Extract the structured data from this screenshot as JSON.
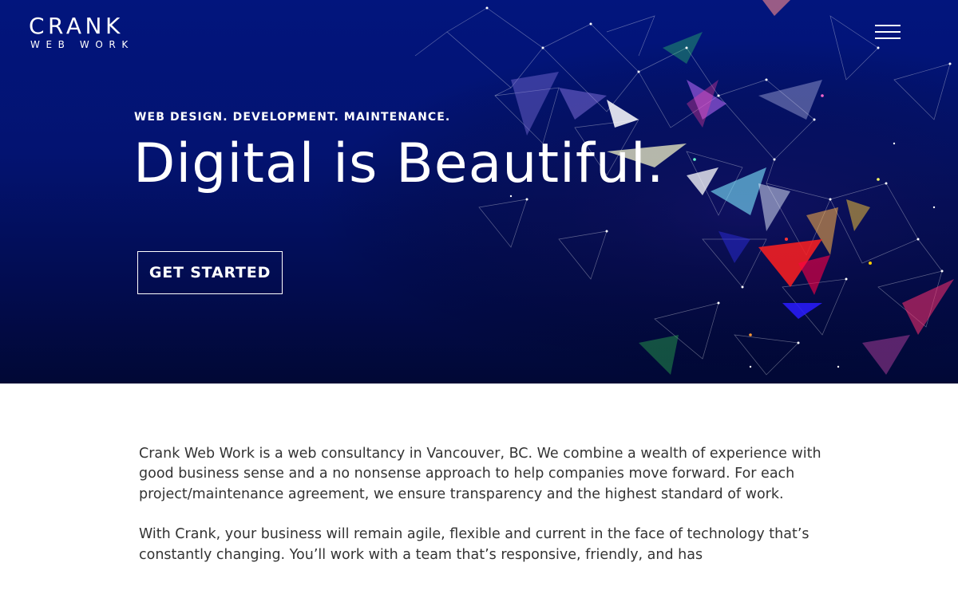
{
  "header": {
    "logo_main": "CRANK",
    "logo_sub": "WEB WORK",
    "menu_icon": "hamburger-menu-icon"
  },
  "hero": {
    "tagline": "WEB DESIGN. DEVELOPMENT. MAINTENANCE.",
    "headline": "Digital is Beautiful.",
    "cta_label": "GET STARTED",
    "background_color": "#02157d",
    "art": "polygon-network"
  },
  "intro": {
    "paragraph_1": "Crank Web Work is a web consultancy in Vancouver, BC. We combine a wealth of experience with good business sense and a no nonsense approach to help companies move forward. For each project/maintenance agreement, we ensure transparency and the highest standard of work.",
    "paragraph_2": "With Crank, your business will remain agile, flexible and current in the face of technology that’s constantly changing. You’ll work with a team that’s responsive, friendly, and has"
  },
  "colors": {
    "hero_bg": "#02157d",
    "text": "#333333",
    "white": "#ffffff"
  }
}
